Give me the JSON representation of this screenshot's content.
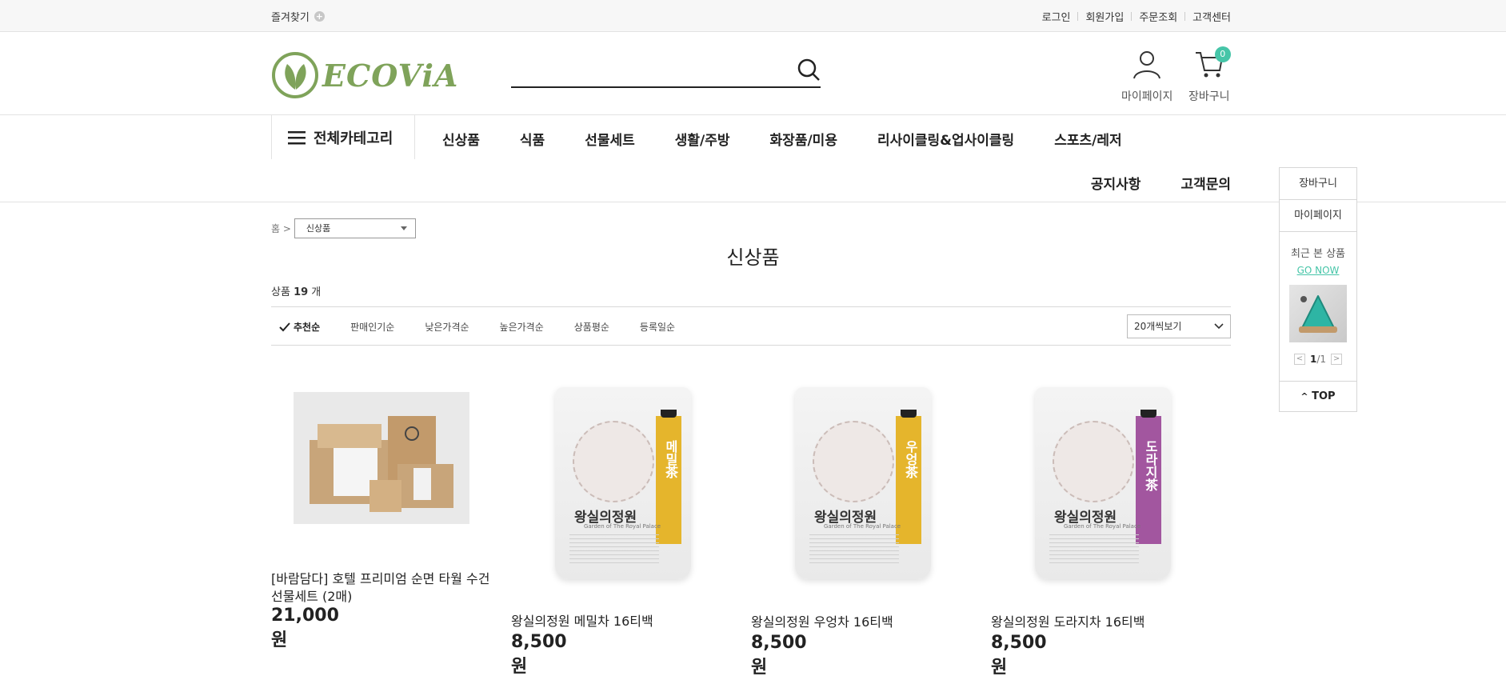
{
  "topbar": {
    "favorites": "즐겨찾기",
    "links": [
      "로그인",
      "회원가입",
      "주문조회",
      "고객센터"
    ]
  },
  "header": {
    "logo_text": "ECOViA",
    "search_placeholder": "",
    "mypage": "마이페이지",
    "cart": "장바구니",
    "cart_count": "0"
  },
  "nav": {
    "all_categories": "전체카테고리",
    "menu": [
      "신상품",
      "식품",
      "선물세트",
      "생활/주방",
      "화장품/미용",
      "리사이클링&업사이클링",
      "스포츠/레저"
    ],
    "menu2": [
      "공지사항",
      "고객문의"
    ]
  },
  "quick": {
    "cart": "장바구니",
    "mypage": "마이페이지",
    "recent": "최근 본 상품",
    "go_now": "GO NOW",
    "page_current": "1",
    "page_total": "/1",
    "top": "TOP"
  },
  "breadcrumb": {
    "home": "홈 >",
    "selected": "신상품"
  },
  "page_title": "신상품",
  "count": {
    "prefix": "상품",
    "value": "19",
    "suffix": "개"
  },
  "sort": {
    "options": [
      "추천순",
      "판매인기순",
      "낮은가격순",
      "높은가격순",
      "상품평순",
      "등록일순"
    ],
    "per_page": "20개씩보기"
  },
  "products": [
    {
      "name": "[바람담다] 호텔 프리미엄 순면 타월 수건 선물세트 (2매)",
      "price": "21,000원"
    },
    {
      "name": "왕실의정원 메밀차 16티백",
      "price": "8,500원",
      "band_text": "메밀茶",
      "band_color": "#e5b52c"
    },
    {
      "name": "왕실의정원 우엉차 16티백",
      "price": "8,500원",
      "band_text": "우엉茶",
      "band_color": "#e5b52c"
    },
    {
      "name": "왕실의정원 도라지차 16티백",
      "price": "8,500원",
      "band_text": "도라지茶",
      "band_color": "#a2569f"
    }
  ],
  "pouch_brand": "왕실의정원",
  "pouch_sub": "Garden of The Royal Palace",
  "colors": {
    "brand_green": "#7fa35a",
    "accent_mint": "#46c5a8"
  }
}
